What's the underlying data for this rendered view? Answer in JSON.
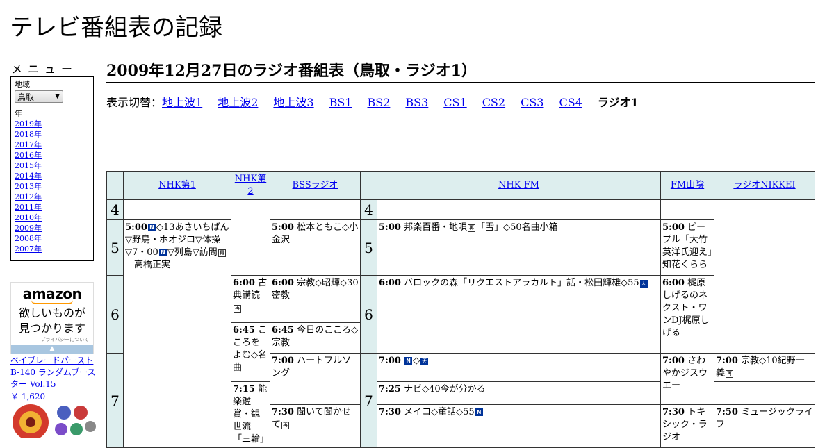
{
  "site_title": "テレビ番組表の記録",
  "menu": {
    "heading": "メニュー",
    "region_label": "地域",
    "region_selected": "鳥取",
    "year_label": "年",
    "years": [
      "2019年",
      "2018年",
      "2017年",
      "2016年",
      "2015年",
      "2014年",
      "2013年",
      "2012年",
      "2011年",
      "2010年",
      "2009年",
      "2008年",
      "2007年"
    ]
  },
  "ad": {
    "logo": "amazon",
    "line1": "欲しいものが",
    "line2": "見つかります",
    "privacy": "プライバシーについて",
    "product_name": "ベイブレードバースト B-140 ランダムブースター Vol.15",
    "product_price": "￥ 1,620"
  },
  "page_title": "2009年12月27日のラジオ番組表（鳥取・ラジオ1）",
  "switch": {
    "label": "表示切替：",
    "links": [
      "地上波1",
      "地上波2",
      "地上波3",
      "BS1",
      "BS2",
      "BS3",
      "CS1",
      "CS2",
      "CS3",
      "CS4"
    ],
    "current": "ラジオ1"
  },
  "channels": [
    "NHK第1",
    "NHK第2",
    "BSSラジオ",
    "NHK FM",
    "FM山陰",
    "ラジオNIKKEI"
  ],
  "hours": [
    "4",
    "5",
    "6",
    "7"
  ],
  "programs": {
    "nhk1_500": {
      "time": "5:00",
      "a": "◇13あさいちばん▽野鳥・ホオジロ▽体操▽7・00",
      "b": "▽列島▽訪問",
      "c": "　高橋正実"
    },
    "bss_500": {
      "time": "5:00",
      "text": "松本ともこ◇小金沢"
    },
    "fm_500": {
      "time": "5:00",
      "a": "邦楽百番・地唄",
      "b": "「雪」◇50名曲小箱"
    },
    "fmsanin_500": {
      "time": "5:00",
      "text": "ピープル「大竹英洋氏迎え」知花くらら"
    },
    "nhk2_600": {
      "time": "6:00",
      "text": "古典講読"
    },
    "bss_600": {
      "time": "6:00",
      "text": "宗教◇昭輝◇30密教"
    },
    "fm_600": {
      "time": "6:00",
      "text": "バロックの森「リクエストアラカルト」話・松田輝雄◇55"
    },
    "fmsanin_600": {
      "time": "6:00",
      "text": "梶原しげるのネクスト・ワンDJ梶原しげる"
    },
    "nhk2_645": {
      "time": "6:45",
      "text": "こころをよむ◇名曲"
    },
    "bss_645": {
      "time": "6:45",
      "text": "今日のこころ◇宗教"
    },
    "bss_700": {
      "time": "7:00",
      "text": "ハートフルソング"
    },
    "fm_700": {
      "time": "7:00"
    },
    "fm_715": {
      "time": "7:15",
      "text": "能楽鑑賞・観世流「三輪」"
    },
    "fmsanin_700": {
      "time": "7:00",
      "text": "さわやかジスウエー"
    },
    "nikkei_700": {
      "time": "7:00",
      "text": "宗教◇10紀野一義"
    },
    "nikkei_725": {
      "time": "7:25",
      "text": "ナビ◇40今が分かる"
    },
    "nhk2_730": {
      "time": "7:30",
      "text": "聞いて聞かせて"
    },
    "bss_730": {
      "time": "7:30",
      "text": "メイコ◇童話◇55"
    },
    "fmsanin_730": {
      "time": "7:30",
      "text": "トキシック・ラジオ"
    },
    "nikkei_750": {
      "time": "7:50",
      "text": "ミュージックライフ"
    }
  },
  "icons": {
    "news": "N",
    "rebroadcast": "再",
    "weather": "天"
  },
  "colors": {
    "header_bg": "#ddeeee",
    "link": "#0000ee",
    "icon_bg": "#003399"
  }
}
